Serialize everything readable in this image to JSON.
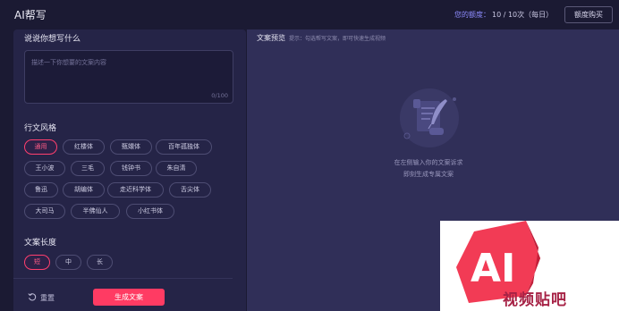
{
  "header": {
    "title": "AI帮写",
    "quota_label": "您的额度：",
    "quota_value": "10 / 10次（每日）",
    "buy_label": "额度购买"
  },
  "prompt": {
    "title": "说说你想写什么",
    "placeholder": "描述一下你想要的文案内容",
    "counter": "0/100"
  },
  "style": {
    "title": "行文风格",
    "options": [
      "通用",
      "红楼体",
      "甄嬛体",
      "百年孤独体",
      "王小波",
      "三毛",
      "钱钟书",
      "朱自清",
      "鲁迅",
      "胡编体",
      "走近科学体",
      "舌尖体",
      "大司马",
      "半佛仙人",
      "小红书体"
    ],
    "selected": "通用"
  },
  "length": {
    "title": "文案长度",
    "options": [
      "短",
      "中",
      "长"
    ],
    "selected": "短"
  },
  "actions": {
    "reset_label": "重置",
    "generate_label": "生成文案"
  },
  "preview": {
    "title": "文案预览",
    "hint": "提示：勾选帮写文案，即可快速生成视频",
    "empty_line1": "在左侧输入你的文案诉求",
    "empty_line2": "即刻生成专属文案"
  },
  "watermark": {
    "logo_text": "AI",
    "text": "视频贴吧"
  },
  "colors": {
    "accent": "#ff3b63",
    "quota": "#8e8cff",
    "panel": "#252447",
    "preview_bg": "#302f58"
  },
  "icons": {
    "reset": "refresh-icon",
    "empty_state": "scroll-quill-icon"
  }
}
